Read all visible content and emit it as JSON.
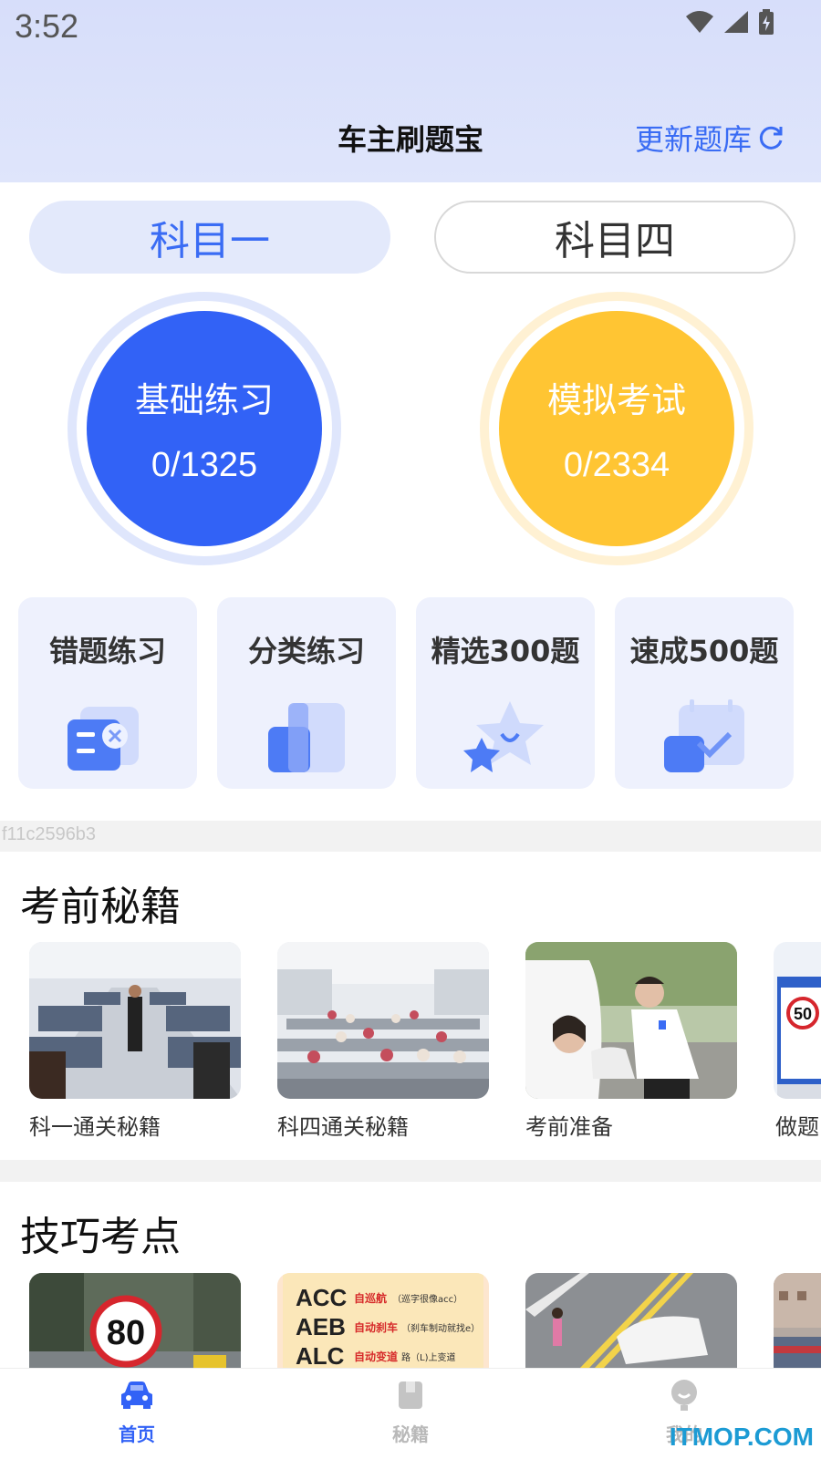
{
  "status_bar": {
    "time": "3:52"
  },
  "header": {
    "title": "车主刷题宝",
    "update_label": "更新题库"
  },
  "tabs": [
    {
      "label": "科目一",
      "active": true
    },
    {
      "label": "科目四",
      "active": false
    }
  ],
  "practice": {
    "basic": {
      "title": "基础练习",
      "count": "0/1325"
    },
    "mock": {
      "title": "模拟考试",
      "count": "0/2334"
    }
  },
  "features": [
    {
      "label": "错题练习",
      "icon": "wrong-question-icon"
    },
    {
      "label": "分类练习",
      "icon": "category-book-icon"
    },
    {
      "label": "精选300题",
      "icon": "star-icon"
    },
    {
      "label": "速成500题",
      "icon": "calendar-check-icon"
    }
  ],
  "ad_code": "f11c2596b3",
  "secrets": {
    "title": "考前秘籍",
    "items": [
      {
        "caption": "科一通关秘籍"
      },
      {
        "caption": "科四通关秘籍"
      },
      {
        "caption": "考前准备"
      },
      {
        "caption": "做题"
      }
    ],
    "sign_text": "50"
  },
  "tips": {
    "title": "技巧考点",
    "speed_sign": "80",
    "acronyms": [
      {
        "abbr": "ACC",
        "hint": "自巡航",
        "note": "（巡字很像acc）"
      },
      {
        "abbr": "AEB",
        "hint": "自动刹车",
        "note": "（刹车制动就找e）"
      },
      {
        "abbr": "ALC",
        "hint": "自动变道",
        "note": "路（L)上变道"
      }
    ]
  },
  "bottom_nav": [
    {
      "label": "首页",
      "icon": "car-icon",
      "active": true
    },
    {
      "label": "秘籍",
      "icon": "book-icon",
      "active": false
    },
    {
      "label": "我的",
      "icon": "profile-icon",
      "active": false
    }
  ],
  "watermark": "ITMOP.COM",
  "colors": {
    "accent": "#3262f6",
    "yellow": "#ffc533",
    "text_blue": "#3a6cf4"
  }
}
